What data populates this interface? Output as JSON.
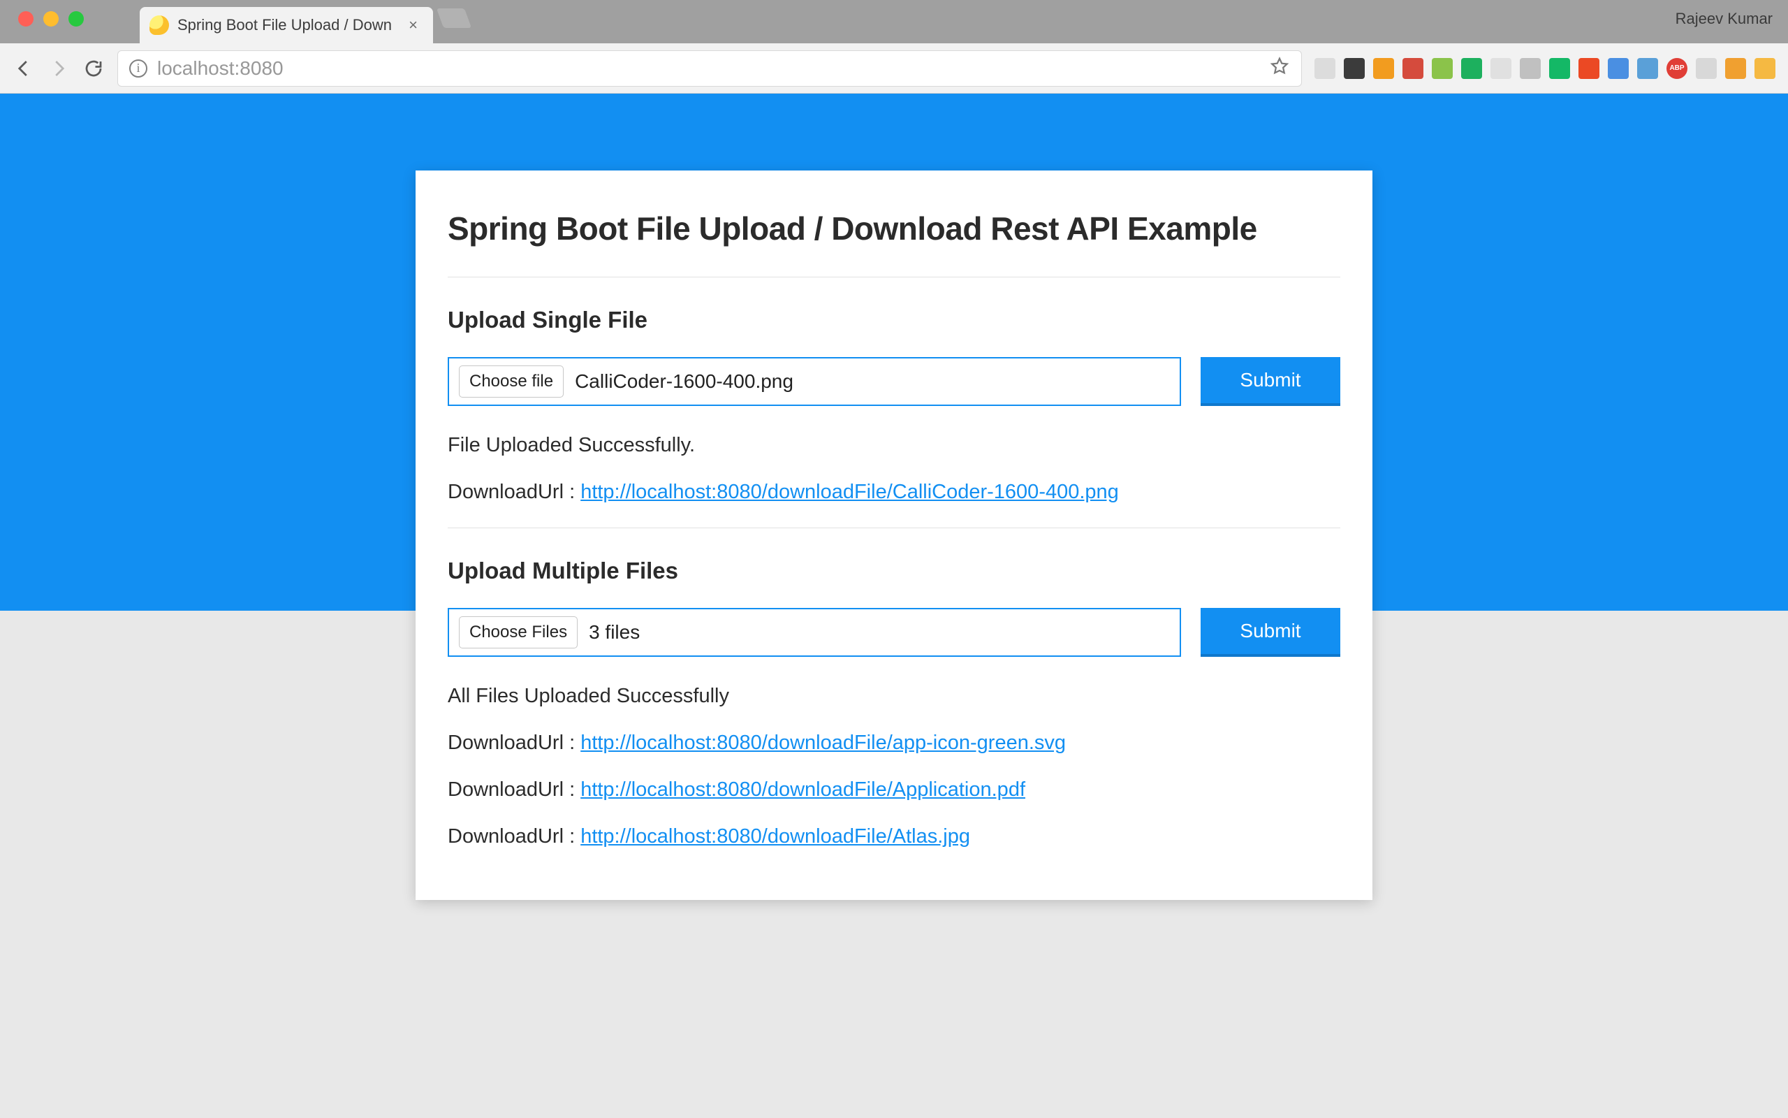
{
  "browser": {
    "tab_title": "Spring Boot File Upload / Down",
    "profile_name": "Rajeev Kumar",
    "url_host": "localhost",
    "url_port": ":8080"
  },
  "page": {
    "title": "Spring Boot File Upload / Download Rest API Example",
    "single": {
      "heading": "Upload Single File",
      "choose_label": "Choose file",
      "filename": "CalliCoder-1600-400.png",
      "submit": "Submit",
      "success_msg": "File Uploaded Successfully.",
      "dl_prefix": "DownloadUrl : ",
      "dl_url": "http://localhost:8080/downloadFile/CalliCoder-1600-400.png"
    },
    "multi": {
      "heading": "Upload Multiple Files",
      "choose_label": "Choose Files",
      "filecount": "3 files",
      "submit": "Submit",
      "success_msg": "All Files Uploaded Successfully",
      "dl_prefix": "DownloadUrl : ",
      "links": [
        "http://localhost:8080/downloadFile/app-icon-green.svg",
        "http://localhost:8080/downloadFile/Application.pdf",
        "http://localhost:8080/downloadFile/Atlas.jpg"
      ]
    }
  },
  "ext_colors": [
    "#dcdcdc",
    "#3b3b3b",
    "#f29c1f",
    "#d54b3d",
    "#8bc34a",
    "#1db05e",
    "#e0e0e0",
    "#c0c0c0",
    "#14b866",
    "#eb4924",
    "#4a8fe2",
    "#5aa0d8",
    "#e03e36",
    "#d8d8d8",
    "#f0a030",
    "#f5b942"
  ]
}
